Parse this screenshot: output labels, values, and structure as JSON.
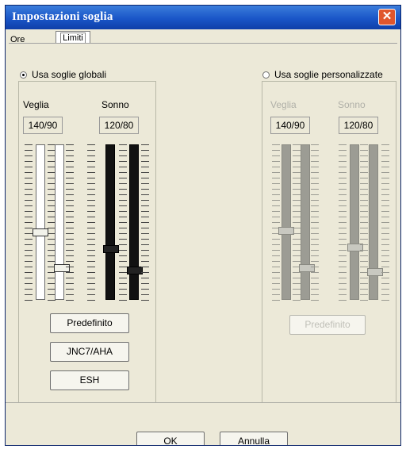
{
  "window": {
    "title": "Impostazioni soglia",
    "close_glyph": "✕"
  },
  "tabs": [
    {
      "label": "Ore"
    },
    {
      "label": "Limiti"
    }
  ],
  "global": {
    "radio_label": "Usa soglie globali",
    "selected": true,
    "veglia": {
      "label": "Veglia",
      "value": "140/90"
    },
    "sonno": {
      "label": "Sonno",
      "value": "120/80"
    },
    "buttons": [
      "Predefinito",
      "JNC7/AHA",
      "ESH"
    ]
  },
  "custom": {
    "radio_label": "Usa soglie personalizzate",
    "selected": false,
    "veglia": {
      "label": "Veglia",
      "value": "140/90"
    },
    "sonno": {
      "label": "Sonno",
      "value": "120/80"
    },
    "buttons": [
      "Predefinito"
    ]
  },
  "footer": {
    "ok_label": "OK",
    "ok_mnemonic": "O",
    "ok_rest": "K",
    "cancel_label": "Annulla",
    "cancel_mnemonic": "A",
    "cancel_rest": "nnulla"
  },
  "colors": {
    "titlebar": "#1a56c8",
    "dialog_bg": "#ece9d8",
    "close_button": "#e0562d"
  }
}
